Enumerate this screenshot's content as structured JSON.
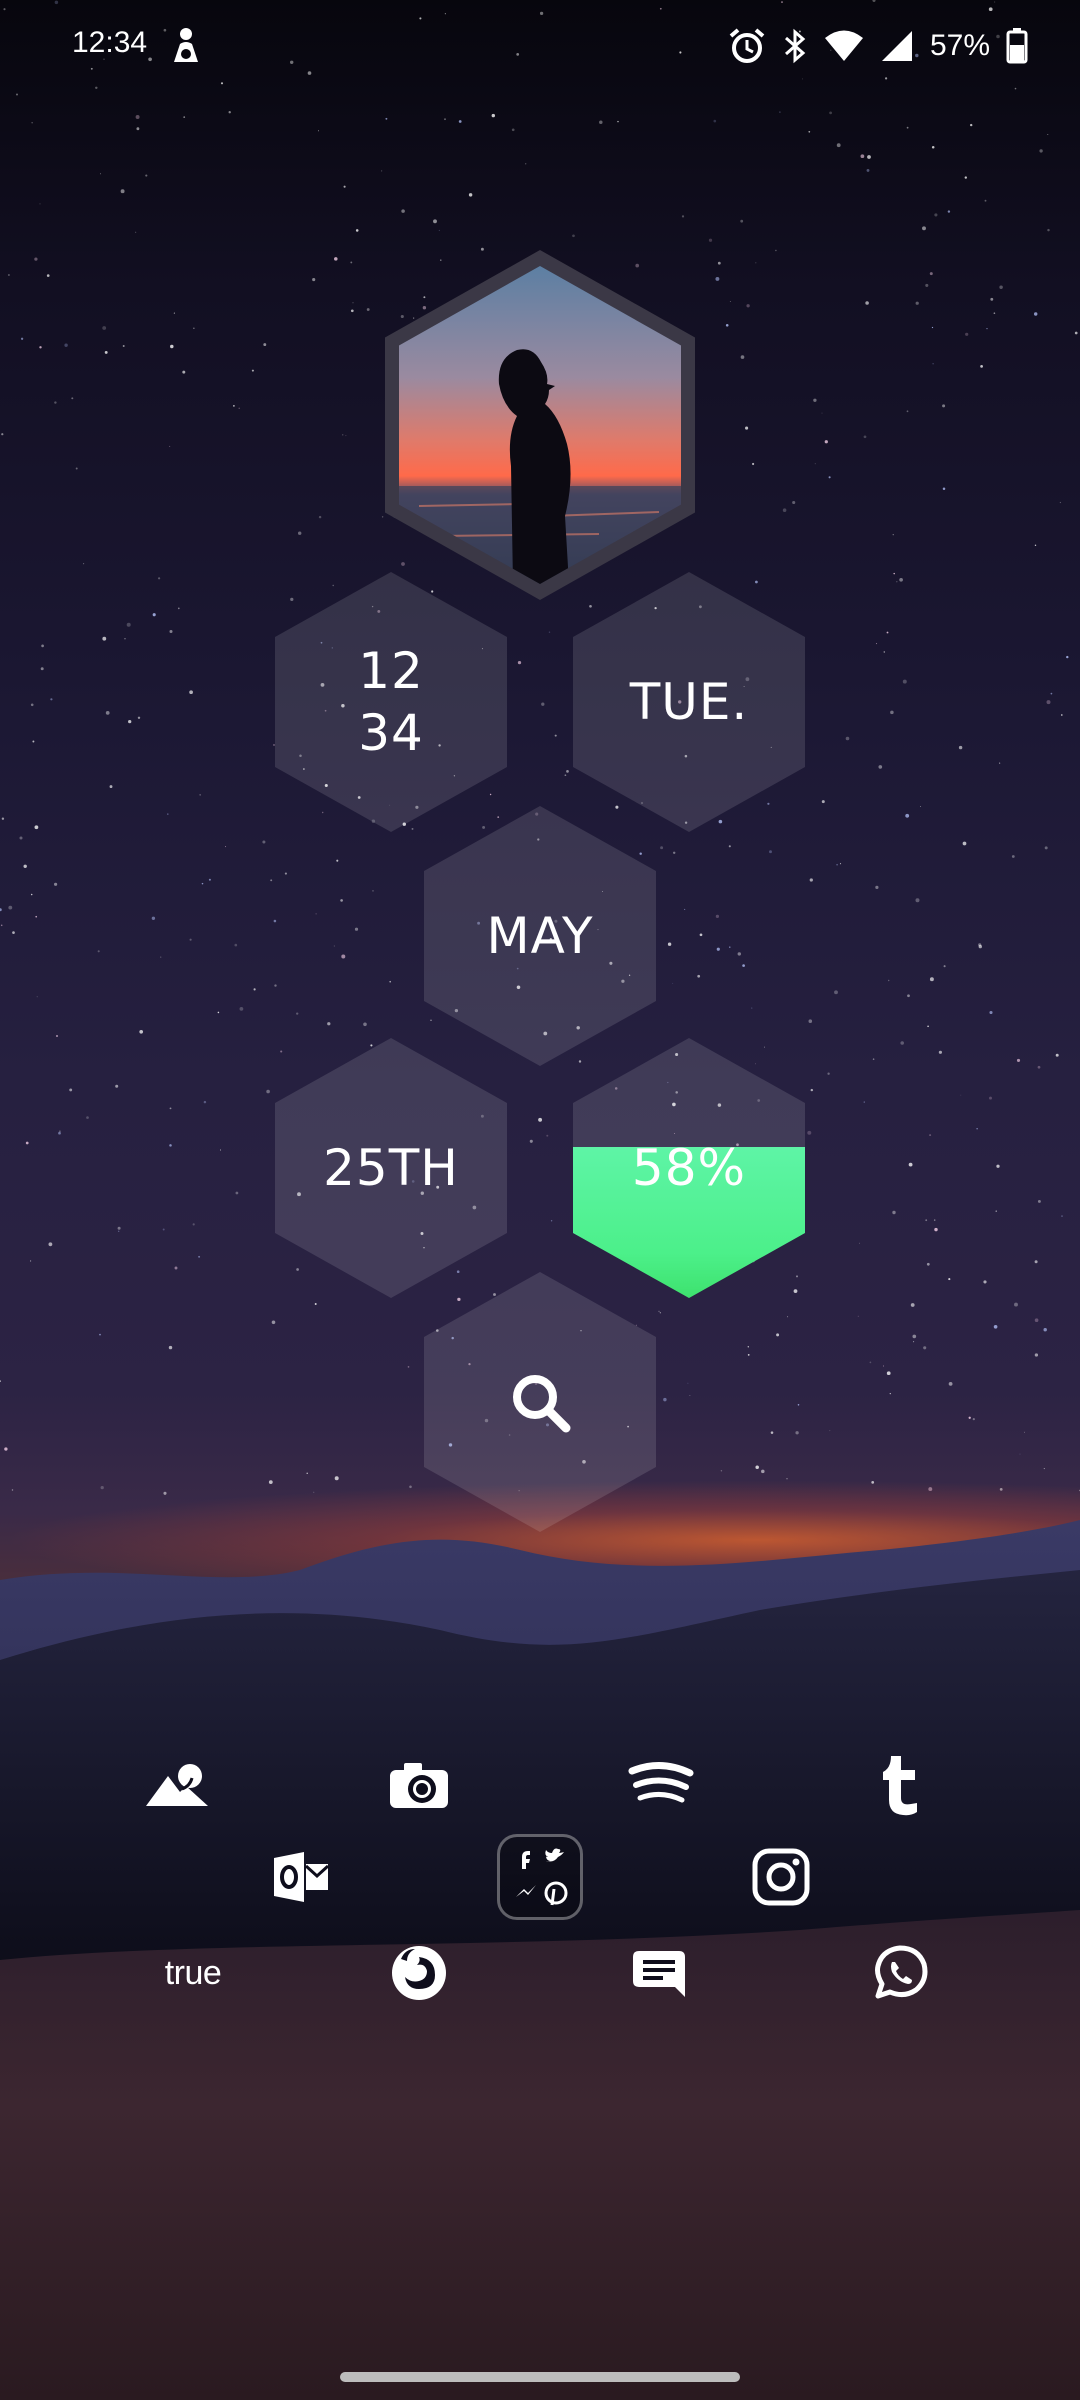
{
  "status_bar": {
    "time": "12:34",
    "battery_percent": "57%",
    "icons": [
      "person-icon",
      "alarm-icon",
      "bluetooth-icon",
      "wifi-icon",
      "signal-icon",
      "battery-icon"
    ]
  },
  "widget": {
    "photo": "silhouette-sunset-photo",
    "clock_hour": "12",
    "clock_minute": "34",
    "weekday": "TUE.",
    "month": "MAY",
    "day": "25TH",
    "battery": "58%",
    "battery_level": 0.58,
    "battery_color": "#4cf08a",
    "search_icon": "search-icon"
  },
  "dock": {
    "row1": [
      "gallery-icon",
      "camera-icon",
      "spotify-icon",
      "tumblr-icon"
    ],
    "row2": [
      "outlook-icon",
      "social-folder-icon",
      "instagram-icon"
    ],
    "folder_apps": [
      "facebook-icon",
      "twitter-icon",
      "messenger-icon",
      "pinterest-icon"
    ],
    "row3_text": "true",
    "row3": [
      "true-app",
      "firefox-icon",
      "messages-icon",
      "whatsapp-icon"
    ]
  }
}
